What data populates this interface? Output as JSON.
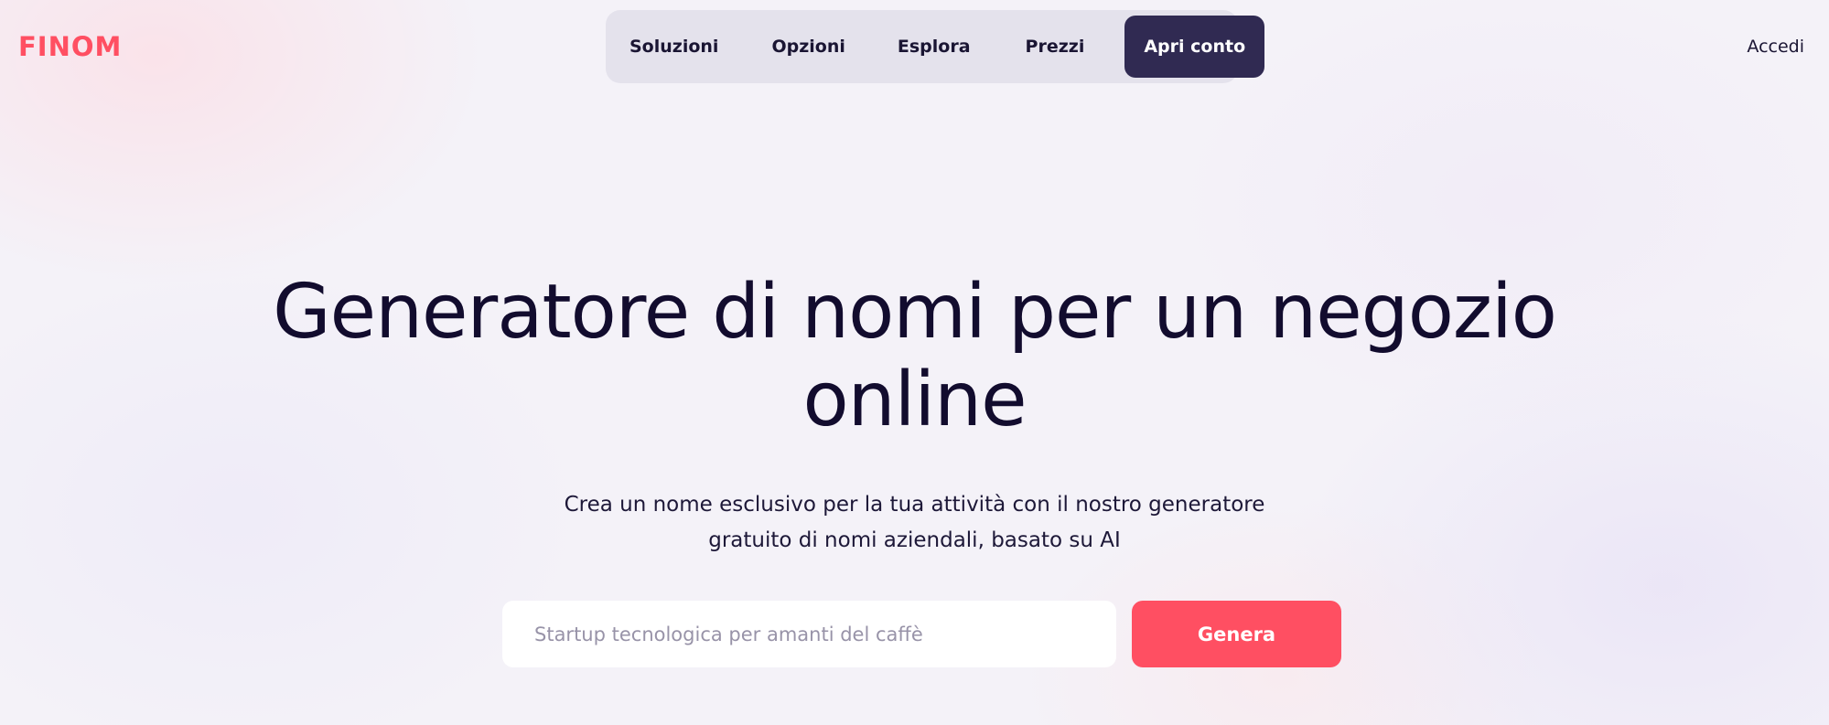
{
  "brand": {
    "logo_text": "FINOM",
    "accent_color": "#ff4f62",
    "dark_color": "#302a52"
  },
  "nav": {
    "items": [
      {
        "label": "Soluzioni"
      },
      {
        "label": "Opzioni"
      },
      {
        "label": "Esplora"
      },
      {
        "label": "Prezzi"
      }
    ],
    "cta_label": "Apri conto"
  },
  "header": {
    "login_label": "Accedi"
  },
  "hero": {
    "title_lines": [
      "Generatore di nomi per un negozio",
      "online"
    ],
    "subtitle_lines": [
      "Crea un nome esclusivo per la tua attività con il nostro generatore",
      "gratuito di nomi aziendali, basato su AI"
    ]
  },
  "generator": {
    "input_value": "",
    "input_placeholder": "Startup tecnologica per amanti del caffè",
    "button_label": "Genera"
  }
}
